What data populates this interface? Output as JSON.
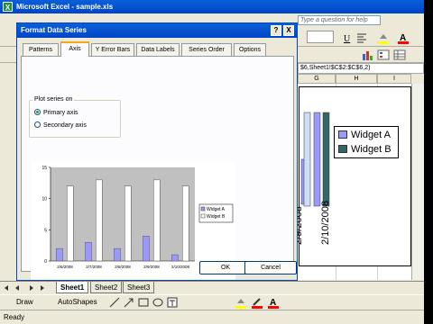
{
  "window": {
    "title": "Microsoft Excel - sample.xls",
    "icon_letter": "X",
    "help_placeholder": "Type a question for help"
  },
  "formula": {
    "text": "$6,Sheet1!$C$2:$C$6,2)"
  },
  "columns": [
    "G",
    "H",
    "I"
  ],
  "sheet_chart": {
    "legend": [
      {
        "name": "Widget A",
        "color": "#9999ff"
      },
      {
        "name": "Widget B",
        "color": "#336666"
      }
    ],
    "date_labels": [
      "2/9/2008",
      "2/10/2008"
    ]
  },
  "sheet_tabs": [
    "Sheet1",
    "Sheet2",
    "Sheet3"
  ],
  "drawbar": {
    "draw_label": "Draw",
    "autoshapes_label": "AutoShapes"
  },
  "status": {
    "text": "Ready"
  },
  "dialog": {
    "title": "Format Data Series",
    "help_button": "?",
    "close_button": "X",
    "tabs": [
      "Patterns",
      "Axis",
      "Y Error Bars",
      "Data Labels",
      "Series Order",
      "Options"
    ],
    "active_tab": "Axis",
    "group_label": "Plot series on",
    "radio_primary": "Primary axis",
    "radio_secondary": "Secondary axis",
    "primary_selected": true,
    "ok_label": "OK",
    "cancel_label": "Cancel"
  },
  "chart_data": {
    "type": "bar",
    "categories": [
      "2/6/2008",
      "2/7/2008",
      "2/8/2008",
      "2/9/2008",
      "2/10/2008"
    ],
    "series": [
      {
        "name": "Widget A",
        "values": [
          2,
          3,
          2,
          4,
          1
        ],
        "color": "#9999ff"
      },
      {
        "name": "Widget B",
        "values": [
          12,
          13,
          12,
          13,
          12
        ],
        "color": "#ffffff"
      }
    ],
    "ylim": [
      0,
      15
    ],
    "yticks": [
      "0",
      "5",
      "10",
      "15"
    ],
    "legend_position": "right",
    "plot_background": "#c0c0c0",
    "grid": false
  }
}
